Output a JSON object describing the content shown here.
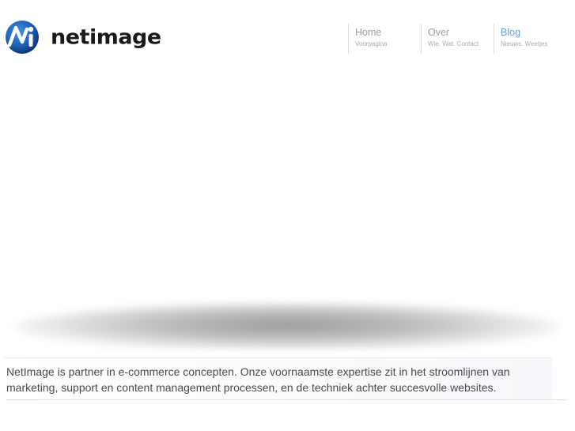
{
  "brand": {
    "name": "netimage",
    "logo_color_primary": "#1a5fb4",
    "logo_color_dark": "#0b2f6b"
  },
  "nav": {
    "items": [
      {
        "title": "Home",
        "subtitle": "Voorpagina",
        "active": false
      },
      {
        "title": "Over",
        "subtitle": "Wie. Wat. Contact",
        "active": false
      },
      {
        "title": "Blog",
        "subtitle": "Nieuws. Weetjes",
        "active": true
      }
    ],
    "active_color": "#6f9fd4"
  },
  "intro": {
    "text": "NetImage is partner in e-commerce concepten. Onze voornaamste expertise zit in het stroomlijnen van marketing, support en content management processen, en de techniek achter succesvolle websites."
  }
}
